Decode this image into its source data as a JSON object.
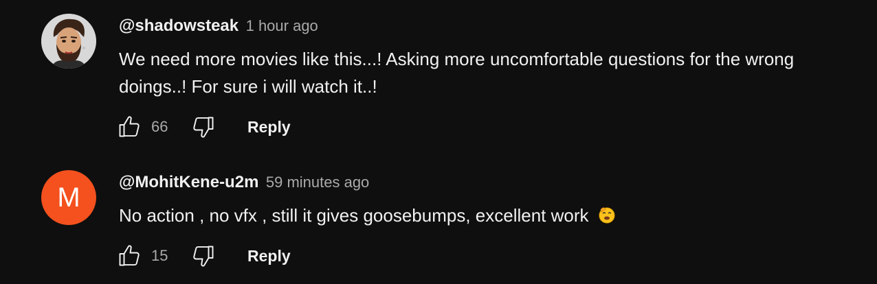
{
  "comments": [
    {
      "author": "@shadowsteak",
      "time": "1 hour ago",
      "text": "We need more movies like this...! Asking more uncomfortable questions for the wrong doings..! For sure i will watch it..!",
      "likes": "66",
      "reply_label": "Reply",
      "avatar_type": "photo"
    },
    {
      "author": "@MohitKene-u2m",
      "time": "59 minutes ago",
      "text": "No action , no vfx , still it gives goosebumps,  excellent work",
      "likes": "15",
      "reply_label": "Reply",
      "avatar_type": "letter",
      "avatar_letter": "M",
      "avatar_color": "#f4511e"
    }
  ],
  "icons": {
    "like": "thumb-up-icon",
    "dislike": "thumb-down-icon",
    "emoji": "smiling-face-with-hand-over-mouth-emoji"
  }
}
